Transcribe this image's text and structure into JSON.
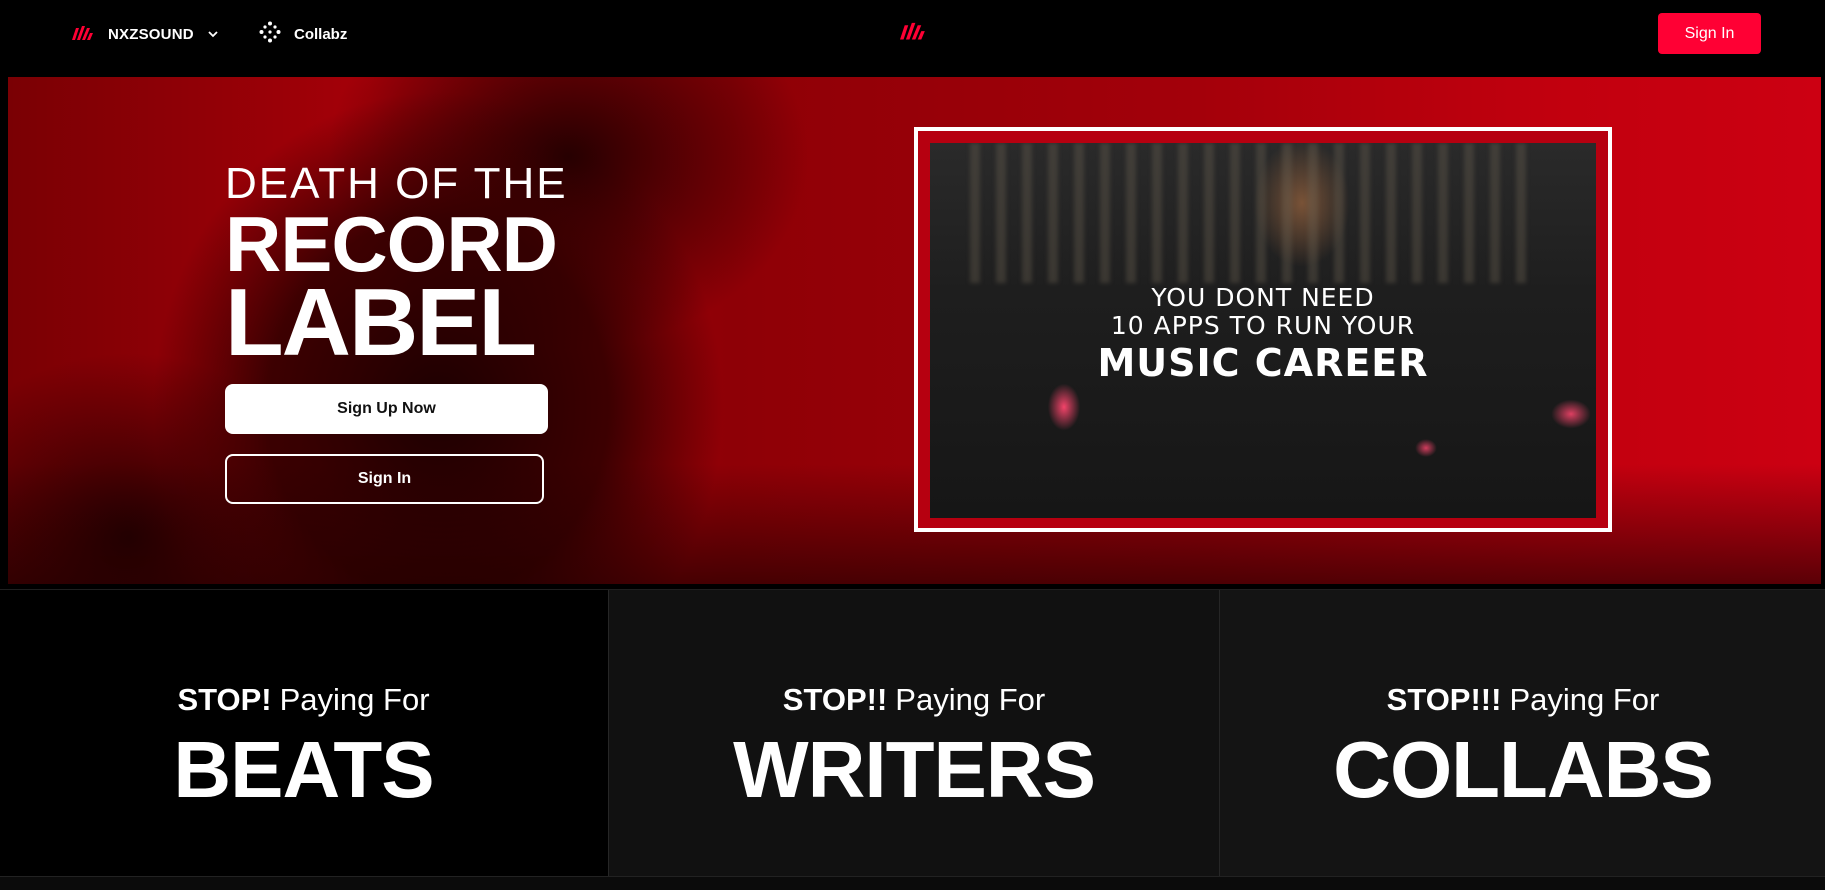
{
  "header": {
    "brand": "NXZSOUND",
    "collabz": "Collabz",
    "sign_in": "Sign In"
  },
  "hero": {
    "line1": "DEATH OF THE",
    "line2": "RECORD",
    "line3": "LABEL",
    "signup_button": "Sign Up Now",
    "signin_button": "Sign In",
    "video": {
      "line1": "YOU DONT NEED",
      "line2": "10 APPS TO RUN YOUR",
      "line3": "MUSIC CAREER"
    }
  },
  "features": [
    {
      "stop": "STOP!",
      "paying": "Paying For",
      "word": "BEATS"
    },
    {
      "stop": "STOP!!",
      "paying": "Paying For",
      "word": "WRITERS"
    },
    {
      "stop": "STOP!!!",
      "paying": "Paying For",
      "word": "COLLABS"
    }
  ],
  "colors": {
    "accent": "#ff0034",
    "hero_red": "#a50008",
    "background": "#000000"
  },
  "icons": {
    "brand_logo": "nxzsound-logo-icon",
    "dropdown": "chevron-down-icon",
    "collabz": "collabz-dots-icon",
    "center_logo": "nxzsound-logo-icon"
  }
}
